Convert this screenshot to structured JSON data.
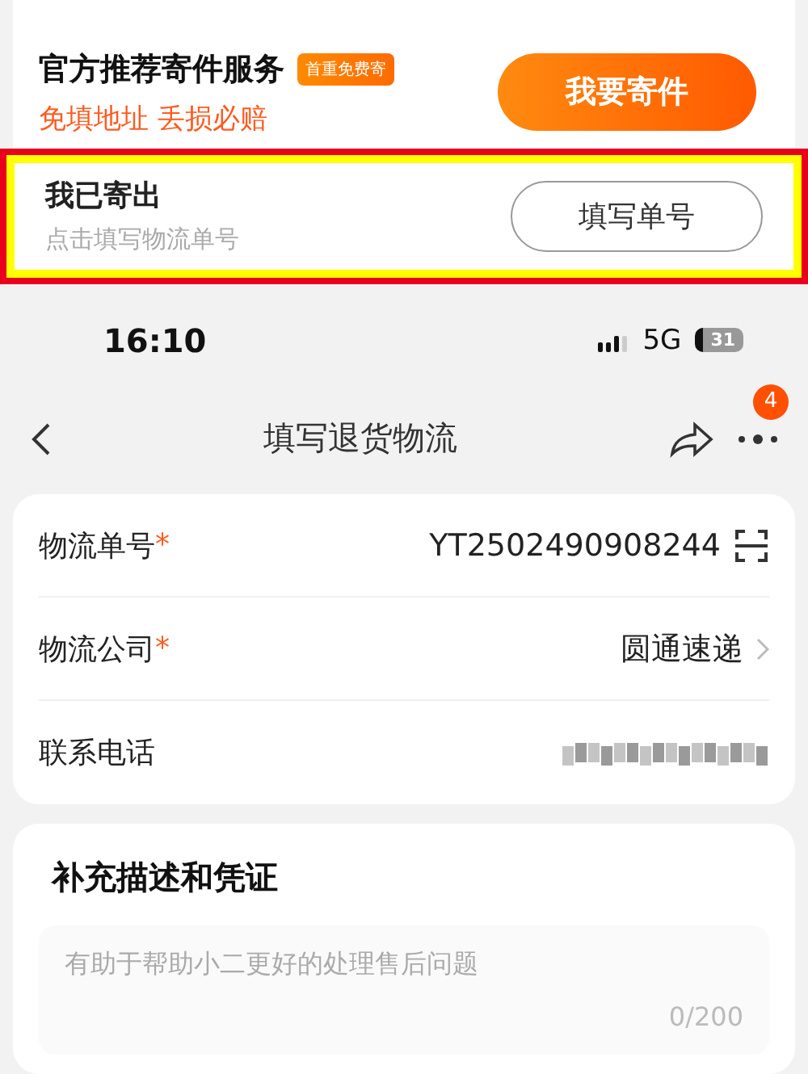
{
  "promo": {
    "title": "官方推荐寄件服务",
    "badge": "首重免费寄",
    "subtitle": "免填地址 丢损必赔",
    "button": "我要寄件"
  },
  "sent": {
    "title": "我已寄出",
    "hint": "点击填写物流单号",
    "button": "填写单号",
    "highlighted": true
  },
  "status_bar": {
    "time": "16:10",
    "network": "5G",
    "battery": "31"
  },
  "nav": {
    "title": "填写退货物流",
    "badge": "4"
  },
  "form": [
    {
      "label": "物流单号",
      "required_mark": "*",
      "value": "YT2502490908244",
      "kind": "scan"
    },
    {
      "label": "物流公司",
      "required_mark": "*",
      "value": "圆通速递",
      "kind": "select"
    },
    {
      "label": "联系电话",
      "kind": "blurred"
    }
  ],
  "description": {
    "title": "补充描述和凭证",
    "placeholder": "有助于帮助小二更好的处理售后问题",
    "counter": "0/200"
  }
}
